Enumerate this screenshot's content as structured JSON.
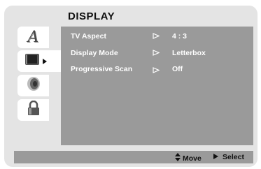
{
  "screen": {
    "title": "DISPLAY"
  },
  "side_tabs": [
    {
      "icon": "language-icon",
      "glyph": "A"
    },
    {
      "icon": "display-tv-icon"
    },
    {
      "icon": "speaker-icon"
    },
    {
      "icon": "lock-icon"
    }
  ],
  "settings": [
    {
      "label": "TV Aspect",
      "value": "4 : 3"
    },
    {
      "label": "Display Mode",
      "value": "Letterbox"
    },
    {
      "label": "Progressive Scan",
      "value": "Off"
    }
  ],
  "footer": {
    "move_label": "Move",
    "select_label": "Select"
  },
  "colors": {
    "content_bg": "#9a9a9a",
    "panel_bg": "#e4e4e4",
    "text_light": "#ffffff"
  }
}
